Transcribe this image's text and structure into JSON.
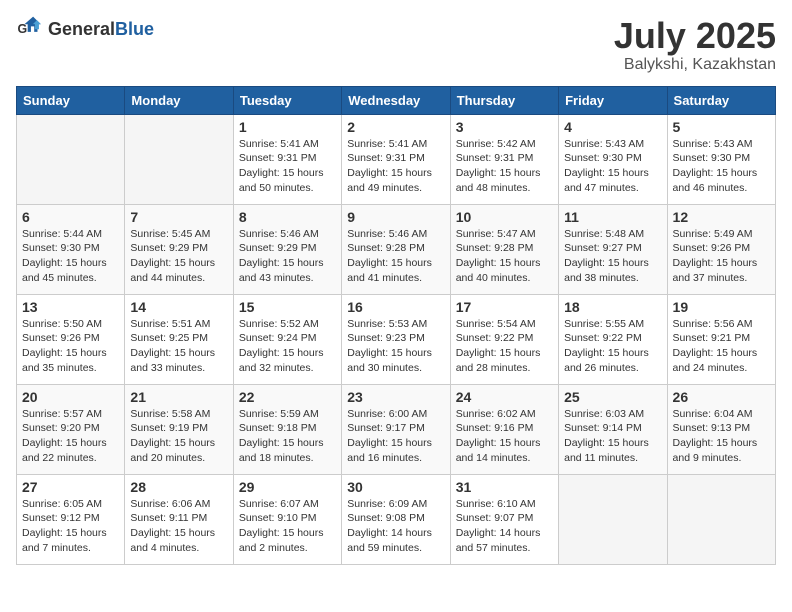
{
  "logo": {
    "general": "General",
    "blue": "Blue"
  },
  "title": {
    "month": "July 2025",
    "location": "Balykshi, Kazakhstan"
  },
  "weekdays": [
    "Sunday",
    "Monday",
    "Tuesday",
    "Wednesday",
    "Thursday",
    "Friday",
    "Saturday"
  ],
  "weeks": [
    [
      {
        "day": null
      },
      {
        "day": null
      },
      {
        "day": "1",
        "sunrise": "Sunrise: 5:41 AM",
        "sunset": "Sunset: 9:31 PM",
        "daylight": "Daylight: 15 hours and 50 minutes."
      },
      {
        "day": "2",
        "sunrise": "Sunrise: 5:41 AM",
        "sunset": "Sunset: 9:31 PM",
        "daylight": "Daylight: 15 hours and 49 minutes."
      },
      {
        "day": "3",
        "sunrise": "Sunrise: 5:42 AM",
        "sunset": "Sunset: 9:31 PM",
        "daylight": "Daylight: 15 hours and 48 minutes."
      },
      {
        "day": "4",
        "sunrise": "Sunrise: 5:43 AM",
        "sunset": "Sunset: 9:30 PM",
        "daylight": "Daylight: 15 hours and 47 minutes."
      },
      {
        "day": "5",
        "sunrise": "Sunrise: 5:43 AM",
        "sunset": "Sunset: 9:30 PM",
        "daylight": "Daylight: 15 hours and 46 minutes."
      }
    ],
    [
      {
        "day": "6",
        "sunrise": "Sunrise: 5:44 AM",
        "sunset": "Sunset: 9:30 PM",
        "daylight": "Daylight: 15 hours and 45 minutes."
      },
      {
        "day": "7",
        "sunrise": "Sunrise: 5:45 AM",
        "sunset": "Sunset: 9:29 PM",
        "daylight": "Daylight: 15 hours and 44 minutes."
      },
      {
        "day": "8",
        "sunrise": "Sunrise: 5:46 AM",
        "sunset": "Sunset: 9:29 PM",
        "daylight": "Daylight: 15 hours and 43 minutes."
      },
      {
        "day": "9",
        "sunrise": "Sunrise: 5:46 AM",
        "sunset": "Sunset: 9:28 PM",
        "daylight": "Daylight: 15 hours and 41 minutes."
      },
      {
        "day": "10",
        "sunrise": "Sunrise: 5:47 AM",
        "sunset": "Sunset: 9:28 PM",
        "daylight": "Daylight: 15 hours and 40 minutes."
      },
      {
        "day": "11",
        "sunrise": "Sunrise: 5:48 AM",
        "sunset": "Sunset: 9:27 PM",
        "daylight": "Daylight: 15 hours and 38 minutes."
      },
      {
        "day": "12",
        "sunrise": "Sunrise: 5:49 AM",
        "sunset": "Sunset: 9:26 PM",
        "daylight": "Daylight: 15 hours and 37 minutes."
      }
    ],
    [
      {
        "day": "13",
        "sunrise": "Sunrise: 5:50 AM",
        "sunset": "Sunset: 9:26 PM",
        "daylight": "Daylight: 15 hours and 35 minutes."
      },
      {
        "day": "14",
        "sunrise": "Sunrise: 5:51 AM",
        "sunset": "Sunset: 9:25 PM",
        "daylight": "Daylight: 15 hours and 33 minutes."
      },
      {
        "day": "15",
        "sunrise": "Sunrise: 5:52 AM",
        "sunset": "Sunset: 9:24 PM",
        "daylight": "Daylight: 15 hours and 32 minutes."
      },
      {
        "day": "16",
        "sunrise": "Sunrise: 5:53 AM",
        "sunset": "Sunset: 9:23 PM",
        "daylight": "Daylight: 15 hours and 30 minutes."
      },
      {
        "day": "17",
        "sunrise": "Sunrise: 5:54 AM",
        "sunset": "Sunset: 9:22 PM",
        "daylight": "Daylight: 15 hours and 28 minutes."
      },
      {
        "day": "18",
        "sunrise": "Sunrise: 5:55 AM",
        "sunset": "Sunset: 9:22 PM",
        "daylight": "Daylight: 15 hours and 26 minutes."
      },
      {
        "day": "19",
        "sunrise": "Sunrise: 5:56 AM",
        "sunset": "Sunset: 9:21 PM",
        "daylight": "Daylight: 15 hours and 24 minutes."
      }
    ],
    [
      {
        "day": "20",
        "sunrise": "Sunrise: 5:57 AM",
        "sunset": "Sunset: 9:20 PM",
        "daylight": "Daylight: 15 hours and 22 minutes."
      },
      {
        "day": "21",
        "sunrise": "Sunrise: 5:58 AM",
        "sunset": "Sunset: 9:19 PM",
        "daylight": "Daylight: 15 hours and 20 minutes."
      },
      {
        "day": "22",
        "sunrise": "Sunrise: 5:59 AM",
        "sunset": "Sunset: 9:18 PM",
        "daylight": "Daylight: 15 hours and 18 minutes."
      },
      {
        "day": "23",
        "sunrise": "Sunrise: 6:00 AM",
        "sunset": "Sunset: 9:17 PM",
        "daylight": "Daylight: 15 hours and 16 minutes."
      },
      {
        "day": "24",
        "sunrise": "Sunrise: 6:02 AM",
        "sunset": "Sunset: 9:16 PM",
        "daylight": "Daylight: 15 hours and 14 minutes."
      },
      {
        "day": "25",
        "sunrise": "Sunrise: 6:03 AM",
        "sunset": "Sunset: 9:14 PM",
        "daylight": "Daylight: 15 hours and 11 minutes."
      },
      {
        "day": "26",
        "sunrise": "Sunrise: 6:04 AM",
        "sunset": "Sunset: 9:13 PM",
        "daylight": "Daylight: 15 hours and 9 minutes."
      }
    ],
    [
      {
        "day": "27",
        "sunrise": "Sunrise: 6:05 AM",
        "sunset": "Sunset: 9:12 PM",
        "daylight": "Daylight: 15 hours and 7 minutes."
      },
      {
        "day": "28",
        "sunrise": "Sunrise: 6:06 AM",
        "sunset": "Sunset: 9:11 PM",
        "daylight": "Daylight: 15 hours and 4 minutes."
      },
      {
        "day": "29",
        "sunrise": "Sunrise: 6:07 AM",
        "sunset": "Sunset: 9:10 PM",
        "daylight": "Daylight: 15 hours and 2 minutes."
      },
      {
        "day": "30",
        "sunrise": "Sunrise: 6:09 AM",
        "sunset": "Sunset: 9:08 PM",
        "daylight": "Daylight: 14 hours and 59 minutes."
      },
      {
        "day": "31",
        "sunrise": "Sunrise: 6:10 AM",
        "sunset": "Sunset: 9:07 PM",
        "daylight": "Daylight: 14 hours and 57 minutes."
      },
      {
        "day": null
      },
      {
        "day": null
      }
    ]
  ]
}
